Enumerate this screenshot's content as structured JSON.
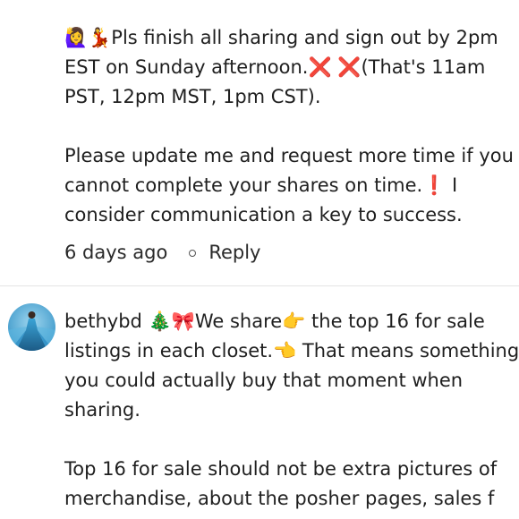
{
  "comment1": {
    "text": "🙋‍♀️💃Pls finish all sharing and sign out by 2pm EST on Sunday afternoon.❌ ❌(That's 11am PST, 12pm MST, 1pm CST).\n\nPlease update me and request more time if you cannot complete your shares on time.❗ I consider communication a key to success.",
    "time": "6 days ago",
    "reply_label": "Reply"
  },
  "comment2": {
    "username": "bethybd",
    "text": " 🎄🎀We share👉 the top 16 for sale listings in each closet.👈 That means something you could actually buy that moment when sharing.\n\nTop 16 for sale should not be extra pictures of merchandise, about the posher pages, sales f"
  },
  "avatar": {
    "icon": "user-avatar-icon",
    "colors": [
      "#2f8fc4",
      "#79c6ea",
      "#1c5b86"
    ]
  }
}
